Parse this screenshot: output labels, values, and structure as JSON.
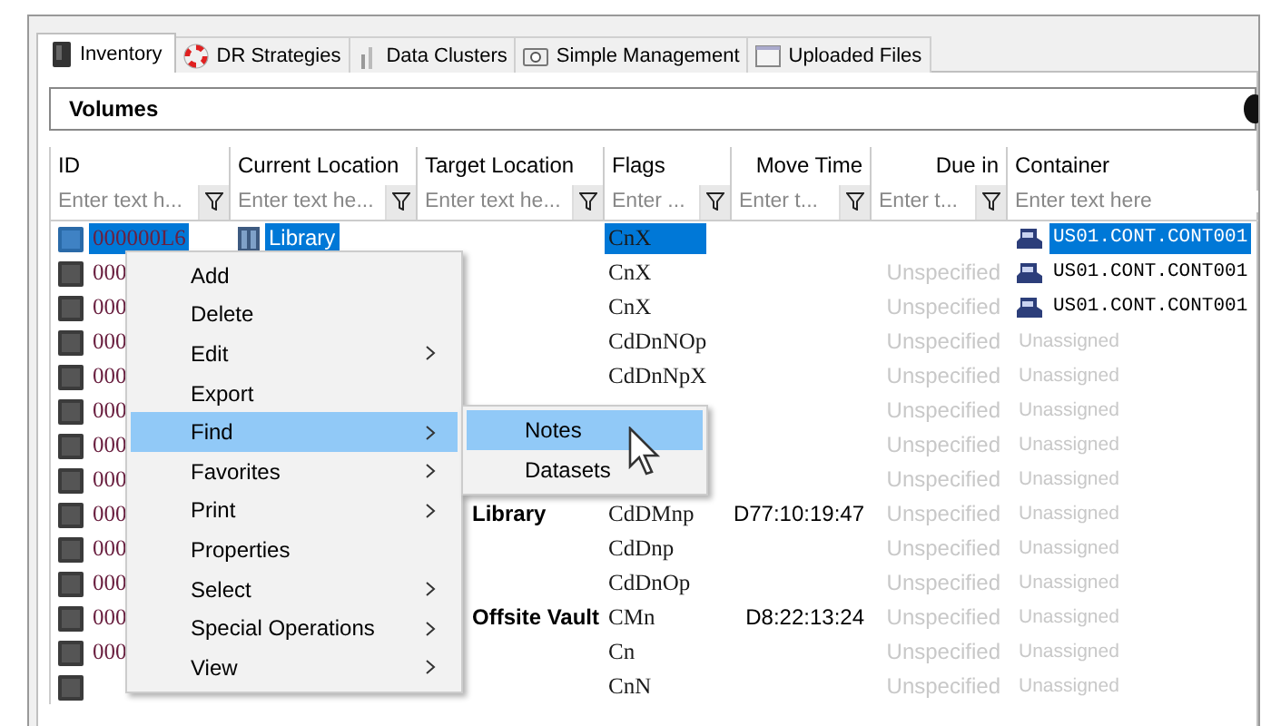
{
  "tabs": [
    {
      "label": "Inventory",
      "selected": true
    },
    {
      "label": "DR Strategies",
      "selected": false
    },
    {
      "label": "Data Clusters",
      "selected": false
    },
    {
      "label": "Simple Management",
      "selected": false
    },
    {
      "label": "Uploaded Files",
      "selected": false
    }
  ],
  "panel": {
    "title": "Volumes"
  },
  "table": {
    "columns": [
      {
        "label": "ID",
        "placeholder": "Enter text h..."
      },
      {
        "label": "Current Location",
        "placeholder": "Enter text he..."
      },
      {
        "label": "Target Location",
        "placeholder": "Enter text he..."
      },
      {
        "label": "Flags",
        "placeholder": "Enter ..."
      },
      {
        "label": "Move Time",
        "placeholder": "Enter t..."
      },
      {
        "label": "Due in",
        "placeholder": "Enter t..."
      },
      {
        "label": "Container",
        "placeholder": "Enter text here"
      }
    ],
    "rows": [
      {
        "id": "000000L6",
        "selected": true,
        "current_location": "Library",
        "flags": "CnX",
        "container": "US01.CONT.CONT001",
        "assigned": true
      },
      {
        "id": "000",
        "selected": false,
        "flags": "CnX",
        "due_in": "Unspecified",
        "container": "US01.CONT.CONT001",
        "assigned": true
      },
      {
        "id": "000",
        "selected": false,
        "flags": "CnX",
        "due_in": "Unspecified",
        "container": "US01.CONT.CONT001",
        "assigned": true
      },
      {
        "id": "000",
        "selected": false,
        "flags": "CdDnNOp",
        "due_in": "Unspecified",
        "container": "Unassigned",
        "assigned": false
      },
      {
        "id": "000",
        "selected": false,
        "flags": "CdDnNpX",
        "due_in": "Unspecified",
        "container": "Unassigned",
        "assigned": false
      },
      {
        "id": "000",
        "selected": false,
        "due_in": "Unspecified",
        "container": "Unassigned",
        "assigned": false
      },
      {
        "id": "000",
        "selected": false,
        "due_in": "Unspecified",
        "container": "Unassigned",
        "assigned": false
      },
      {
        "id": "000",
        "selected": false,
        "due_in": "Unspecified",
        "container": "Unassigned",
        "assigned": false
      },
      {
        "id": "000",
        "selected": false,
        "target_location": "Library",
        "flags": "CdDMnp",
        "move_time": "D77:10:19:47",
        "due_in": "Unspecified",
        "container": "Unassigned",
        "assigned": false
      },
      {
        "id": "000",
        "selected": false,
        "flags": "CdDnp",
        "due_in": "Unspecified",
        "container": "Unassigned",
        "assigned": false
      },
      {
        "id": "000",
        "selected": false,
        "flags": "CdDnOp",
        "due_in": "Unspecified",
        "container": "Unassigned",
        "assigned": false
      },
      {
        "id": "000",
        "selected": false,
        "target_location": "Offsite Vault",
        "flags": "CMn",
        "move_time": "D8:22:13:24",
        "due_in": "Unspecified",
        "container": "Unassigned",
        "assigned": false
      },
      {
        "id": "000",
        "selected": false,
        "flags": "Cn",
        "due_in": "Unspecified",
        "container": "Unassigned",
        "assigned": false
      },
      {
        "selected": false,
        "flags": "CnN",
        "due_in": "Unspecified",
        "container": "Unassigned",
        "assigned": false
      }
    ]
  },
  "context_menu": {
    "items": [
      {
        "label": "Add",
        "has_submenu": false,
        "selected": false
      },
      {
        "label": "Delete",
        "has_submenu": false,
        "selected": false
      },
      {
        "label": "Edit",
        "has_submenu": true,
        "selected": false
      },
      {
        "label": "Export",
        "has_submenu": false,
        "selected": false
      },
      {
        "label": "Find",
        "has_submenu": true,
        "selected": true
      },
      {
        "label": "Favorites",
        "has_submenu": true,
        "selected": false
      },
      {
        "label": "Print",
        "has_submenu": true,
        "selected": false
      },
      {
        "label": "Properties",
        "has_submenu": false,
        "selected": false
      },
      {
        "label": "Select",
        "has_submenu": true,
        "selected": false
      },
      {
        "label": "Special Operations",
        "has_submenu": true,
        "selected": false
      },
      {
        "label": "View",
        "has_submenu": true,
        "selected": false
      }
    ],
    "submenu": [
      {
        "label": "Notes",
        "selected": true
      },
      {
        "label": "Datasets",
        "selected": false
      }
    ]
  }
}
